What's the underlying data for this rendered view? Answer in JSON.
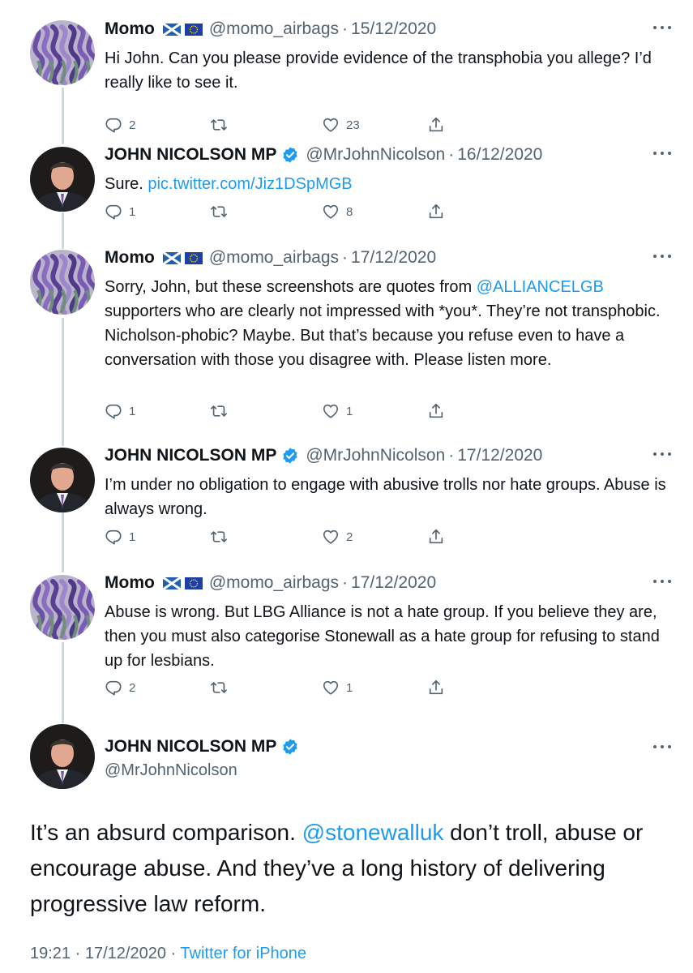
{
  "colors": {
    "link": "#1d9bf0",
    "secondary_text": "#536471",
    "thread_line": "#cfd9de",
    "verified_badge": "#1d9bf0"
  },
  "tweets": [
    {
      "name": "Momo",
      "flags": [
        "scotland-flag",
        "eu-flag"
      ],
      "verified": false,
      "handle": "@momo_airbags",
      "dot": "·",
      "date": "15/12/2020",
      "text": [
        {
          "t": "Hi John. Can you please provide evidence of the transphobia you allege? I’d really like to see it.",
          "link": false
        }
      ],
      "replies": "2",
      "retweets": "",
      "likes": "23",
      "avatar_icon": "purple-ribbons-avatar"
    },
    {
      "name": "JOHN NICOLSON MP",
      "flags": [],
      "verified": true,
      "handle": "@MrJohnNicolson",
      "dot": "·",
      "date": "16/12/2020",
      "text": [
        {
          "t": "Sure. ",
          "link": false
        },
        {
          "t": "pic.twitter.com/Jiz1DSpMGB",
          "link": true
        }
      ],
      "replies": "1",
      "retweets": "",
      "likes": "8",
      "avatar_icon": "man-in-suit-avatar"
    },
    {
      "name": "Momo",
      "flags": [
        "scotland-flag",
        "eu-flag"
      ],
      "verified": false,
      "handle": "@momo_airbags",
      "dot": "·",
      "date": "17/12/2020",
      "text": [
        {
          "t": "Sorry, John, but these screenshots are quotes from ",
          "link": false
        },
        {
          "t": "@ALLIANCELGB",
          "link": true
        },
        {
          "t": " supporters who are clearly not impressed with *you*. They’re not transphobic. Nicholson-phobic? Maybe. But that’s because you refuse even to have a conversation with those you disagree with. Please listen more.",
          "link": false
        }
      ],
      "replies": "1",
      "retweets": "",
      "likes": "1",
      "avatar_icon": "purple-ribbons-avatar"
    },
    {
      "name": "JOHN NICOLSON MP",
      "flags": [],
      "verified": true,
      "handle": "@MrJohnNicolson",
      "dot": "·",
      "date": "17/12/2020",
      "text": [
        {
          "t": "I’m under no obligation to engage with abusive trolls nor hate groups. Abuse is always wrong.",
          "link": false
        }
      ],
      "replies": "1",
      "retweets": "",
      "likes": "2",
      "avatar_icon": "man-in-suit-avatar"
    },
    {
      "name": "Momo",
      "flags": [
        "scotland-flag",
        "eu-flag"
      ],
      "verified": false,
      "handle": "@momo_airbags",
      "dot": "·",
      "date": "17/12/2020",
      "text": [
        {
          "t": "Abuse is wrong. But LBG Alliance is not a hate group. If you believe they are, then you must also categorise Stonewall as a hate group for refusing to stand up for lesbians.",
          "link": false
        }
      ],
      "replies": "2",
      "retweets": "",
      "likes": "1",
      "avatar_icon": "purple-ribbons-avatar"
    }
  ],
  "main_tweet": {
    "name": "JOHN NICOLSON MP",
    "verified": true,
    "handle": "@MrJohnNicolson",
    "text": [
      {
        "t": "It’s an absurd comparison. ",
        "link": false
      },
      {
        "t": "@stonewalluk",
        "link": true
      },
      {
        "t": " don’t troll, abuse or encourage abuse. And they’ve a long history of delivering progressive law reform.",
        "link": false
      }
    ],
    "time": "19:21",
    "dot": "·",
    "date": "17/12/2020",
    "dot2": "·",
    "source": "Twitter for iPhone",
    "avatar_icon": "man-in-suit-avatar"
  },
  "icons": {
    "reply": "reply-icon",
    "retweet": "retweet-icon",
    "like": "heart-icon",
    "share": "share-icon",
    "more": "more-options-icon",
    "verified": "verified-badge-icon"
  }
}
